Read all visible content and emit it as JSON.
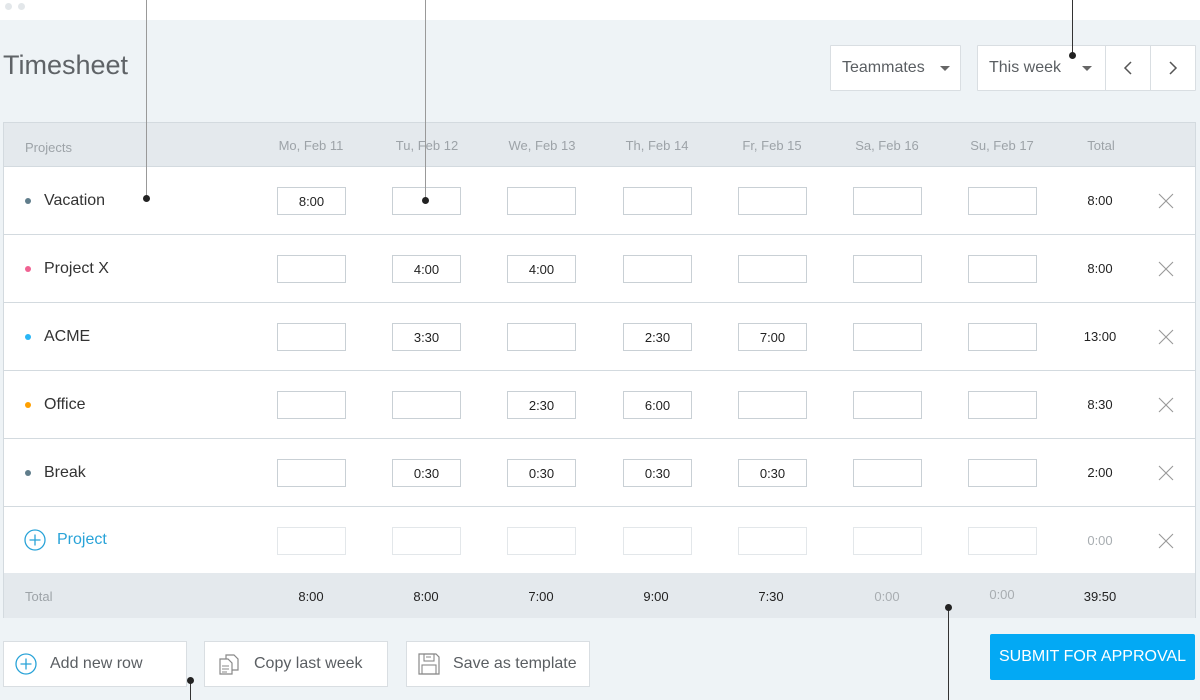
{
  "header": {
    "title": "Timesheet",
    "teammates_label": "Teammates",
    "period_label": "This week"
  },
  "table": {
    "columns": [
      "Projects",
      "Mo, Feb 11",
      "Tu, Feb 12",
      "We, Feb 13",
      "Th, Feb 14",
      "Fr, Feb 15",
      "Sa, Feb 16",
      "Su, Feb 17",
      "Total"
    ],
    "rows": [
      {
        "project": "Vacation",
        "color": "#607d8b",
        "cells": [
          "8:00",
          "",
          "",
          "",
          "",
          "",
          ""
        ],
        "total": "8:00"
      },
      {
        "project": "Project X",
        "color": "#f06292",
        "cells": [
          "",
          "4:00",
          "4:00",
          "",
          "",
          "",
          ""
        ],
        "total": "8:00"
      },
      {
        "project": "ACME",
        "color": "#29b6f6",
        "cells": [
          "",
          "3:30",
          "",
          "2:30",
          "7:00",
          "",
          ""
        ],
        "total": "13:00"
      },
      {
        "project": "Office",
        "color": "#ffa000",
        "cells": [
          "",
          "",
          "2:30",
          "6:00",
          "",
          "",
          ""
        ],
        "total": "8:30"
      },
      {
        "project": "Break",
        "color": "#607d8b",
        "cells": [
          "",
          "0:30",
          "0:30",
          "0:30",
          "0:30",
          "",
          ""
        ],
        "total": "2:00"
      }
    ],
    "new_row": {
      "label": "Project",
      "total": "0:00"
    },
    "footer": {
      "label": "Total",
      "values": [
        "8:00",
        "8:00",
        "7:00",
        "9:00",
        "7:30",
        "0:00",
        "0:00"
      ],
      "grand_total": "39:50"
    }
  },
  "actions": {
    "add_row": "Add new row",
    "copy_week": "Copy last week",
    "save_template": "Save as template",
    "submit": "SUBMIT FOR APPROVAL"
  },
  "colors": {
    "accent": "#03a9f4",
    "link": "#29a3d8"
  }
}
